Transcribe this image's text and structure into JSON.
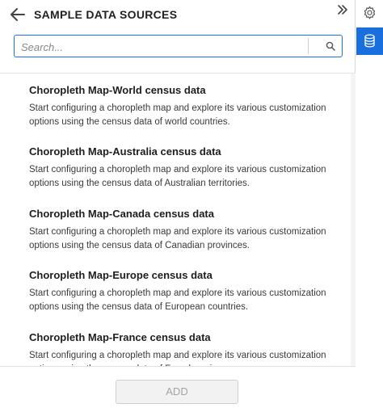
{
  "header": {
    "title": "SAMPLE DATA SOURCES",
    "back_icon": "arrow-left-icon",
    "collapse_icon": "double-chevron-right-icon"
  },
  "search": {
    "placeholder": "Search...",
    "value": "",
    "icon": "search-icon"
  },
  "items": [
    {
      "title": "Choropleth Map-World census data",
      "description": "Start configuring a choropleth map and explore its various customization options using the census data of world countries."
    },
    {
      "title": "Choropleth Map-Australia census data",
      "description": "Start configuring a choropleth map and explore its various customization options using the census data of Australian territories."
    },
    {
      "title": "Choropleth Map-Canada census data",
      "description": "Start configuring a choropleth map and explore its various customization options using the census data of Canadian provinces."
    },
    {
      "title": "Choropleth Map-Europe census data",
      "description": "Start configuring a choropleth map and explore its various customization options using the census data of European countries."
    },
    {
      "title": "Choropleth Map-France census data",
      "description": "Start configuring a choropleth map and explore its various customization options using the census data of French regions."
    }
  ],
  "footer": {
    "add_label": "ADD",
    "add_enabled": false
  },
  "side_rail": {
    "items": [
      {
        "icon": "gear-icon",
        "active": false
      },
      {
        "icon": "database-icon",
        "active": true
      }
    ]
  },
  "colors": {
    "accent": "#1a6fdf",
    "search_border": "#1a73e8",
    "disabled_button_bg": "#f2f2f2",
    "disabled_button_text": "#a5a5a5"
  }
}
